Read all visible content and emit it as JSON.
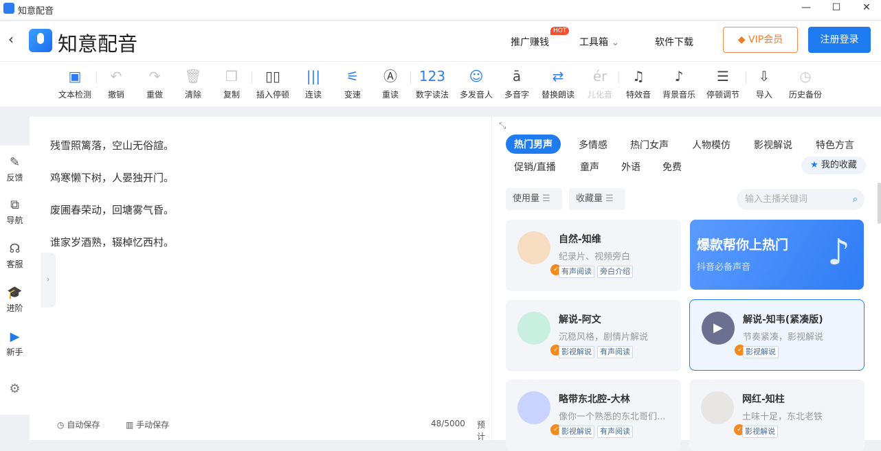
{
  "window": {
    "title": "知意配音",
    "controls": [
      "—",
      "☐",
      "✕"
    ]
  },
  "header": {
    "brand": "知意配音",
    "promote": "推广赚钱",
    "hot": "HOT",
    "toolbox": "工具箱",
    "download": "软件下载",
    "vip": "VIP会员",
    "login": "注册登录"
  },
  "toolbar": [
    {
      "label": "文本检测",
      "icon": "text-check-icon",
      "glyph": "▣"
    },
    {
      "label": "撤销",
      "icon": "undo-icon",
      "glyph": "↶"
    },
    {
      "label": "重做",
      "icon": "redo-icon",
      "glyph": "↷"
    },
    {
      "label": "清除",
      "icon": "trash-icon",
      "glyph": "🗑"
    },
    {
      "label": "复制",
      "icon": "copy-icon",
      "glyph": "❐"
    },
    {
      "label": "插入停顿",
      "icon": "pause-insert-icon",
      "glyph": "▯▯"
    },
    {
      "label": "连读",
      "icon": "link-read-icon",
      "glyph": "|||"
    },
    {
      "label": "变速",
      "icon": "speed-icon",
      "glyph": "⚟"
    },
    {
      "label": "重读",
      "icon": "stress-icon",
      "glyph": "Ⓐ"
    },
    {
      "label": "数字读法",
      "icon": "number-icon",
      "glyph": "123"
    },
    {
      "label": "多发音人",
      "icon": "multi-speaker-icon",
      "glyph": "☺"
    },
    {
      "label": "多音字",
      "icon": "polyphone-icon",
      "glyph": "ā"
    },
    {
      "label": "替换朗读",
      "icon": "replace-icon",
      "glyph": "⇄"
    },
    {
      "label": "儿化音",
      "icon": "erhua-icon",
      "glyph": "ér"
    },
    {
      "label": "特效音",
      "icon": "music-note-icon",
      "glyph": "♫"
    },
    {
      "label": "背景音乐",
      "icon": "bgm-icon",
      "glyph": "♪"
    },
    {
      "label": "停顿调节",
      "icon": "pause-adjust-icon",
      "glyph": "☰"
    },
    {
      "label": "导入",
      "icon": "import-icon",
      "glyph": "⇩"
    },
    {
      "label": "历史备份",
      "icon": "history-icon",
      "glyph": "◷"
    }
  ],
  "sidebar": [
    {
      "label": "反馈",
      "glyph": "✎"
    },
    {
      "label": "导航",
      "glyph": "⧉"
    },
    {
      "label": "客服",
      "glyph": "☊"
    },
    {
      "label": "进阶",
      "glyph": "🎓"
    },
    {
      "label": "新手",
      "glyph": "▶"
    }
  ],
  "editor": {
    "lines": [
      "残雪照篱落，空山无俗諠。",
      "鸡寒懒下树，人晏独开门。",
      "废圃春荣动，回塘雾气昏。",
      "谁家岁酒熟，辍棹忆西村。"
    ],
    "auto_save": "自动保存",
    "manual_save": "手动保存",
    "count": "48/5000",
    "estimate": "预计"
  },
  "panel": {
    "tabs_row1": [
      "热门男声",
      "多情感",
      "热门女声",
      "人物模仿",
      "影视解说",
      "特色方言"
    ],
    "tabs_row2": [
      "促销/直播",
      "童声",
      "外语",
      "免费"
    ],
    "favorites": "我的收藏",
    "sort": [
      "使用量",
      "收藏量"
    ],
    "search_placeholder": "输入主播关键词",
    "banner": {
      "title": "爆款帮你上热门",
      "subtitle": "抖音必备声音"
    },
    "voices": [
      {
        "name": "自然-知维",
        "desc": "纪录片、视频旁白",
        "tags": [
          "有声阅读",
          "旁白介绍"
        ],
        "color": "#f6dcc0"
      },
      {
        "name": "解说-阿文",
        "desc": "沉稳风格，剧情片解说",
        "tags": [
          "影视解说",
          "有声阅读"
        ],
        "color": "#c9efe0"
      },
      {
        "name": "解说-知韦(紧凑版)",
        "desc": "节奏紧凑，影视解说",
        "tags": [
          "影视解说"
        ],
        "color": "#6c7090"
      },
      {
        "name": "略带东北腔-大林",
        "desc": "像你一个熟悉的东北哥们...",
        "tags": [
          "影视解说",
          "有声阅读"
        ],
        "color": "#c8d4ff"
      },
      {
        "name": "网红-知柱",
        "desc": "土味十足，东北老铁",
        "tags": [
          "影视解说"
        ],
        "color": "#e8e6e2"
      }
    ]
  }
}
